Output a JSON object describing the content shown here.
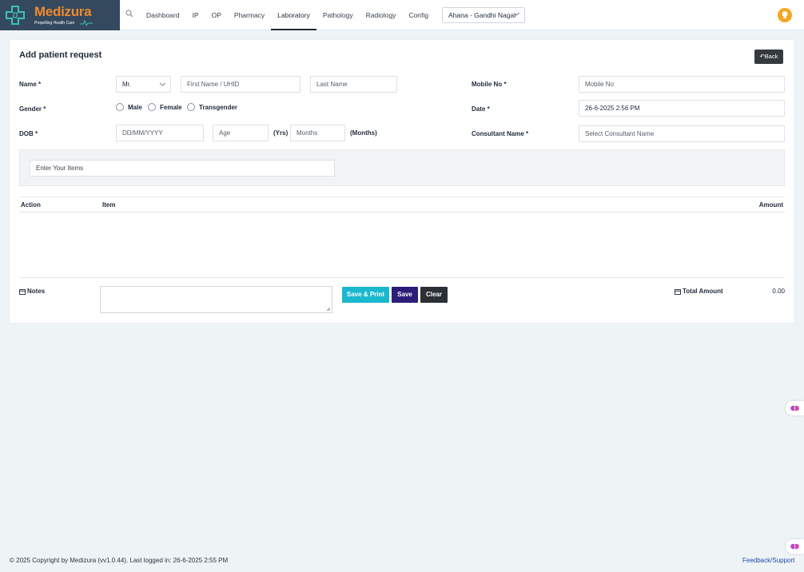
{
  "brand": {
    "name": "Medizura",
    "tagline": "Propelling Health Care"
  },
  "nav": [
    "Dashboard",
    "IP",
    "OP",
    "Pharmacy",
    "Laboratory",
    "Pathology",
    "Radiology",
    "Config"
  ],
  "nav_active": "Laboratory",
  "branch": {
    "selected": "Ahana - Gandhi Nagar"
  },
  "form": {
    "title": "Add patient request",
    "back_label": "Back",
    "name_label": "Name *",
    "title_select": "Mr.",
    "first_name_placeholder": "First Name / UHID",
    "last_name_placeholder": "Last Name",
    "gender_label": "Gender *",
    "gender_options": [
      "Male",
      "Female",
      "Transgender"
    ],
    "dob_label": "DOB *",
    "dob_placeholder": "DD/MM/YYYY",
    "age_placeholder": "Age",
    "yrs_label": "(Yrs)",
    "months_placeholder": "Months",
    "months_label": "(Months)",
    "mobile_label": "Mobile No *",
    "mobile_placeholder": "Mobile No",
    "date_label": "Date *",
    "date_value": "26-6-2025 2:56 PM",
    "consultant_label": "Consultant Name *",
    "consultant_placeholder": "Select Consultant Name",
    "items_placeholder": "Enter Your Items"
  },
  "table": {
    "columns": [
      "Action",
      "Item",
      "Amount"
    ]
  },
  "notes_label": "Notes",
  "buttons": {
    "save_print": "Save & Print",
    "save": "Save",
    "clear": "Clear"
  },
  "total": {
    "label": "Total Amount",
    "value": "0.00"
  },
  "footer": {
    "copyright": "© 2025 Copyright by Medizura (vv1.0.44). Last logged in: 26-6-2025 2:55 PM",
    "support": "Feedback/Support"
  },
  "colors": {
    "brand_bg": "#34495e",
    "brand_orange": "#f08a2c",
    "save_print": "#1ab8cf",
    "save": "#2d1d7a",
    "clear": "#2b3035"
  }
}
